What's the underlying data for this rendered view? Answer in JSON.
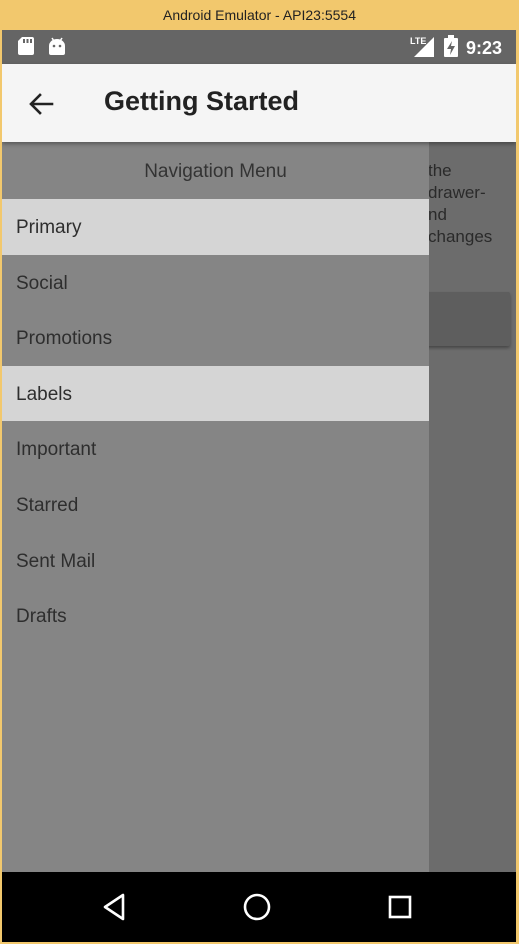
{
  "window": {
    "title": "Android Emulator - API23:5554"
  },
  "status_bar": {
    "time": "9:23",
    "network_label": "LTE",
    "left_icons": [
      "sd-card-icon",
      "android-icon"
    ],
    "right_icons": [
      "signal-icon",
      "battery-icon"
    ]
  },
  "app_bar": {
    "title": "Getting Started",
    "back_icon": "arrow-back-icon"
  },
  "content": {
    "text": "the\ndrawer-\nnd\nchanges"
  },
  "drawer": {
    "header": "Navigation Menu",
    "items": [
      {
        "label": "Primary",
        "selected": true
      },
      {
        "label": "Social",
        "selected": false
      },
      {
        "label": "Promotions",
        "selected": false
      },
      {
        "label": "Labels",
        "selected": true
      },
      {
        "label": "Important",
        "selected": false
      },
      {
        "label": "Starred",
        "selected": false
      },
      {
        "label": "Sent Mail",
        "selected": false
      },
      {
        "label": "Drafts",
        "selected": false
      }
    ]
  },
  "nav_bar": {
    "buttons": [
      "back-triangle-icon",
      "home-circle-icon",
      "recents-square-icon"
    ]
  },
  "colors": {
    "title_bar": "#f2c86d",
    "app_bar": "#f5f5f5",
    "drawer": "#858585",
    "selected_item": "#d5d5d5",
    "scrim": "#6c6c6c"
  }
}
